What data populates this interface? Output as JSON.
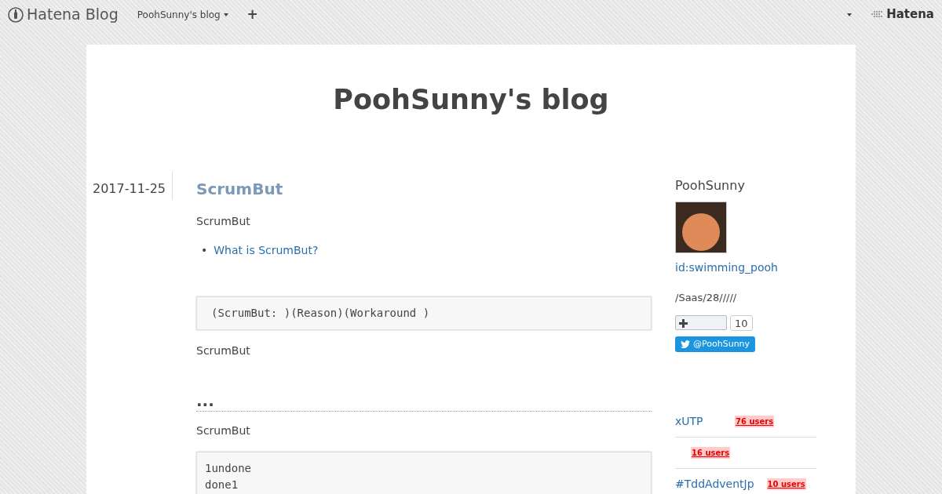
{
  "topbar": {
    "logo": "Hatena Blog",
    "blog_menu": "PoohSunny's blog",
    "add": "+",
    "brand": "Hatena"
  },
  "blog_title": "PoohSunny's blog",
  "entry": {
    "date": "2017-11-25",
    "title": "ScrumBut",
    "content": [
      {
        "kind": "para",
        "text": "ScrumBut"
      },
      {
        "kind": "list",
        "marker": "•",
        "items": [
          "What is ScrumBut?"
        ]
      },
      {
        "kind": "code",
        "lines": [
          "(ScrumBut: )(Reason)(Workaround )"
        ]
      },
      {
        "kind": "para",
        "text": "ScrumBut"
      },
      {
        "kind": "heading",
        "text": "..."
      },
      {
        "kind": "para",
        "text": "ScrumBut"
      },
      {
        "kind": "code",
        "lines": [
          "1undone",
          "done1"
        ]
      }
    ]
  },
  "sidebar": {
    "profile": {
      "name": "PoohSunny",
      "id": "id:swimming_pooh",
      "bio": "/Saas/28/////",
      "star_count": "10",
      "twitter": "@PoohSunny"
    },
    "bookmarks": [
      {
        "title": "xUTP",
        "users": "76 users"
      },
      {
        "users": "16 users"
      },
      {
        "title": "#TddAdventJp",
        "users": "10 users"
      }
    ]
  }
}
